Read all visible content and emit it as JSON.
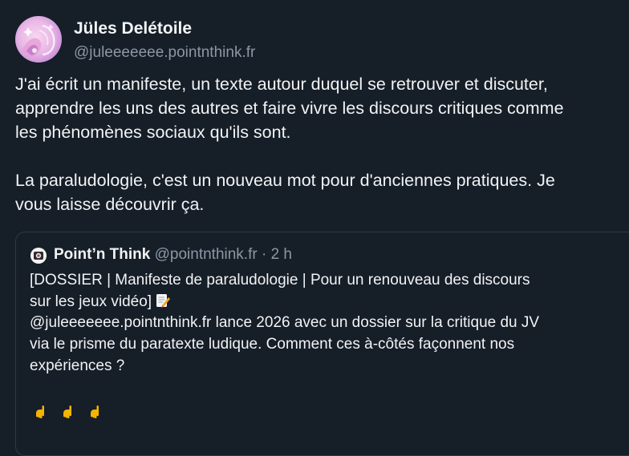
{
  "post": {
    "author_name": "Jüles Delétoile",
    "author_handle": "@juleeeeeee.pointnthink.fr",
    "text": "J'ai écrit un manifeste, un texte autour duquel se retrouver et discuter,\napprendre les uns des autres et faire vivre les discours critiques comme\nles phénomènes sociaux qu'ils sont.\n\nLa paraludologie, c'est un nouveau mot pour d'anciennes pratiques. Je\nvous laisse découvrir ça."
  },
  "quote": {
    "name": "Point’n Think",
    "handle": "@pointnthink.fr",
    "separator": " · ",
    "time": "2 h",
    "text_part1": "[DOSSIER | Manifeste de paraludologie | Pour un renouveau des discours\nsur les jeux vidéo]",
    "text_part2": "@juleeeeeee.pointnthink.fr lance 2026 avec un dossier sur la critique du JV\nvia le prisme du paratexte ludique. Comment ces à-côtés façonnent nos\nexpériences ?",
    "emojis": [
      "pointing-down-hand",
      "pointing-down-hand",
      "pointing-down-hand"
    ]
  },
  "colors": {
    "background": "#161e27",
    "text": "#f1f3f5",
    "muted": "#8b98a5",
    "border": "#2e3945"
  }
}
